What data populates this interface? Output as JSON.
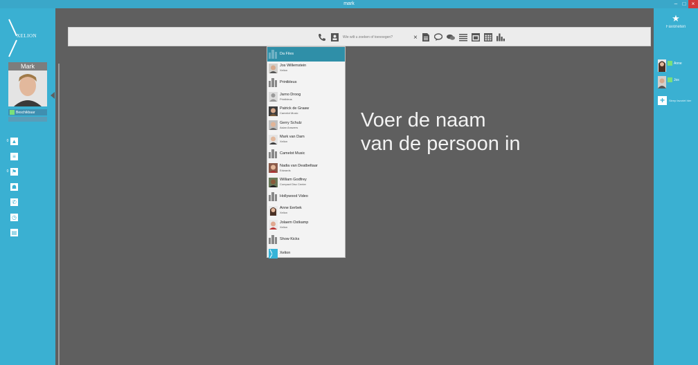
{
  "window": {
    "title": "mark",
    "controls": [
      "–",
      "□",
      "×"
    ]
  },
  "app": {
    "brand": "XELION"
  },
  "user": {
    "name": "Mark",
    "status": "Beschikbaar"
  },
  "nav": {
    "items": [
      {
        "icon": "contacts-icon",
        "glyph": "▲",
        "badge": "0"
      },
      {
        "icon": "notes-icon",
        "glyph": "≡",
        "badge": ""
      },
      {
        "icon": "flag-icon",
        "glyph": "⚑",
        "badge": "0"
      },
      {
        "icon": "people-icon",
        "glyph": "☗",
        "badge": ""
      },
      {
        "icon": "phone-icon",
        "glyph": "✆",
        "badge": ""
      },
      {
        "icon": "history-icon",
        "glyph": "◷",
        "badge": ""
      },
      {
        "icon": "calendar-icon",
        "glyph": "▤",
        "badge": ""
      }
    ]
  },
  "favorites": {
    "title": "Favorieten",
    "items": [
      {
        "name": "Anne"
      },
      {
        "name": "Jos"
      }
    ],
    "add_hint": "Sleep favoriet hier"
  },
  "toolbar": {
    "search_placeholder": "Wie wilt u zoeken of toevoegen?",
    "clear": "×",
    "icons": [
      "phone-icon",
      "contact-card-icon",
      "document-icon",
      "chat-icon",
      "chat-group-icon",
      "list-icon",
      "calendar-icon",
      "table-icon",
      "bar-chart-icon"
    ]
  },
  "instruction": {
    "line1": "Voer de naam",
    "line2": "van de persoon in"
  },
  "results": [
    {
      "name": "Da Files",
      "sub": "",
      "type": "org",
      "selected": true
    },
    {
      "name": "Jos Willemstein",
      "sub": "Xelion",
      "type": "person"
    },
    {
      "name": "Printbleus",
      "sub": "",
      "type": "org"
    },
    {
      "name": "Jarno Droog",
      "sub": "Printbleus",
      "type": "placeholder"
    },
    {
      "name": "Patrick de Graaw",
      "sub": "Camelot Music",
      "type": "person"
    },
    {
      "name": "Gerry Schulz",
      "sub": "Asian Answers",
      "type": "person"
    },
    {
      "name": "Mark van Dam",
      "sub": "Xelion",
      "type": "person"
    },
    {
      "name": "Camelot Music",
      "sub": "",
      "type": "org"
    },
    {
      "name": "Nadia van Deatbeltaar",
      "sub": "Edwards",
      "type": "person"
    },
    {
      "name": "William Godfrey",
      "sub": "Compact Disc Center",
      "type": "person"
    },
    {
      "name": "Hollywood Video",
      "sub": "",
      "type": "org"
    },
    {
      "name": "Anne Eerbek",
      "sub": "Xelion",
      "type": "person"
    },
    {
      "name": "Jolaem Ostkamp",
      "sub": "Xelion",
      "type": "person"
    },
    {
      "name": "Show Kicks",
      "sub": "",
      "type": "org"
    },
    {
      "name": "Xelion",
      "sub": "",
      "type": "xelion"
    }
  ]
}
